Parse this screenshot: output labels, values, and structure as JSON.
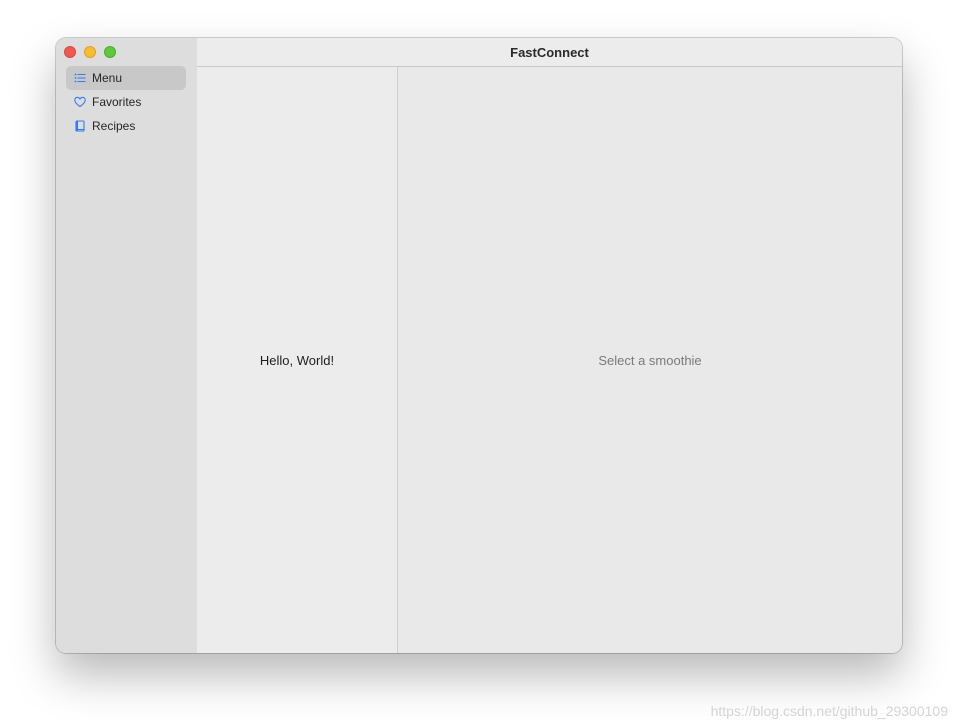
{
  "window": {
    "title": "FastConnect"
  },
  "sidebar": {
    "items": [
      {
        "label": "Menu",
        "icon": "list-icon",
        "selected": true
      },
      {
        "label": "Favorites",
        "icon": "heart-icon",
        "selected": false
      },
      {
        "label": "Recipes",
        "icon": "book-icon",
        "selected": false
      }
    ]
  },
  "content": {
    "text": "Hello, World!"
  },
  "detail": {
    "placeholder": "Select a smoothie"
  },
  "watermark": "https://blog.csdn.net/github_29300109",
  "colors": {
    "accent": "#2f7bf5",
    "close": "#ee5a52",
    "minimize": "#f5bd2f",
    "zoom": "#5fc83d"
  }
}
